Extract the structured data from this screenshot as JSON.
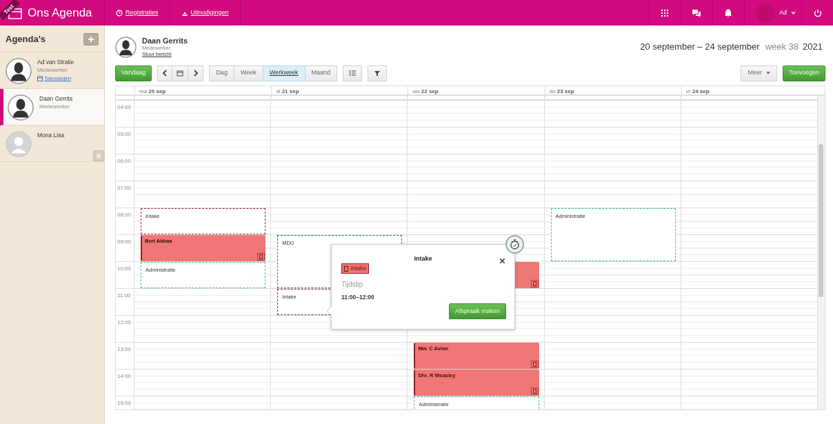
{
  "app": {
    "ribbon": "Test",
    "title": "Ons Agenda"
  },
  "nav": [
    {
      "label": "Registraties"
    },
    {
      "label": "Uitnodigingen"
    }
  ],
  "user_menu": {
    "name": "Ad"
  },
  "sidebar": {
    "title": "Agenda's",
    "items": [
      {
        "name": "Ad van Stratie",
        "role": "Medewerker",
        "action": "Toevoegen",
        "selected": false,
        "removable": false
      },
      {
        "name": "Daan Gerrits",
        "role": "Medewerker",
        "selected": true,
        "removable": false
      },
      {
        "name": "Mona Lisa",
        "selected": false,
        "removable": true
      }
    ]
  },
  "agenda": {
    "name": "Daan Gerrits",
    "role": "Medewerker",
    "link": "Stuur bericht",
    "range": "20 september – 24 september",
    "week": "week 38",
    "year": "2021"
  },
  "toolbar": {
    "today": "Vandaag",
    "views": [
      {
        "label": "Dag",
        "selected": false
      },
      {
        "label": "Week",
        "selected": false
      },
      {
        "label": "Werkweek",
        "selected": true
      },
      {
        "label": "Maand",
        "selected": false
      }
    ],
    "more": "Meer",
    "add": "Toevoegen"
  },
  "calendar": {
    "days": [
      "ma **20 sep**",
      "di **21 sep**",
      "wo **22 sep**",
      "do **23 sep**",
      "vr **24 sep**"
    ],
    "rows": [
      {
        "time": "04:00"
      },
      {
        "time": "05:00"
      },
      {
        "time": "06:00"
      },
      {
        "time": "07:00"
      },
      {
        "time": "08:00",
        "cells": [
          {
            "kind": "availability",
            "title": "Intake",
            "color": "#8e2b35"
          },
          {
            "kind": "empty"
          },
          {
            "kind": "empty"
          },
          {
            "kind": "availability",
            "title": "Administratie",
            "color": "#3cbcb0",
            "continues": true
          },
          {
            "kind": "empty"
          }
        ]
      },
      {
        "time": "09:00",
        "cells": [
          {
            "kind": "appointment",
            "title": "Bert Abbas"
          },
          {
            "kind": "availability",
            "title": "MDO",
            "color": "#2b7c64",
            "continues": true
          },
          {
            "kind": "empty"
          },
          {
            "kind": "empty"
          },
          {
            "kind": "empty"
          }
        ]
      },
      {
        "time": "10:00",
        "cells": [
          {
            "kind": "availability",
            "title": "Administratie",
            "color": "#3cbcb0"
          },
          {
            "kind": "empty"
          },
          {
            "kind": "appointment"
          },
          {
            "kind": "empty"
          },
          {
            "kind": "empty"
          }
        ]
      },
      {
        "time": "11:00",
        "cells": [
          {
            "kind": "empty"
          },
          {
            "kind": "availability",
            "title": "Intake",
            "color": "#8e2b35"
          },
          {
            "kind": "empty"
          },
          {
            "kind": "empty"
          },
          {
            "kind": "empty"
          }
        ]
      },
      {
        "time": "12:00"
      },
      {
        "time": "13:00",
        "cells": [
          {
            "kind": "empty"
          },
          {
            "kind": "empty"
          },
          {
            "kind": "appointment",
            "title": "Mw. C Avion"
          },
          {
            "kind": "empty"
          },
          {
            "kind": "empty"
          }
        ]
      },
      {
        "time": "14:00",
        "cells": [
          {
            "kind": "empty"
          },
          {
            "kind": "empty"
          },
          {
            "kind": "appointment",
            "title": "Dhr. R Weasley"
          },
          {
            "kind": "empty"
          },
          {
            "kind": "empty"
          }
        ]
      },
      {
        "time": "15:00",
        "cells": [
          {
            "kind": "empty"
          },
          {
            "kind": "empty"
          },
          {
            "kind": "availability",
            "title": "Administratie",
            "color": "#3cbcb0"
          },
          {
            "kind": "empty"
          },
          {
            "kind": "empty"
          }
        ]
      }
    ]
  },
  "popover": {
    "title": "Intake",
    "tag": "Intake",
    "label": "Tijdstip",
    "time": "11:00–12:00",
    "button": "Afspraak maken"
  }
}
